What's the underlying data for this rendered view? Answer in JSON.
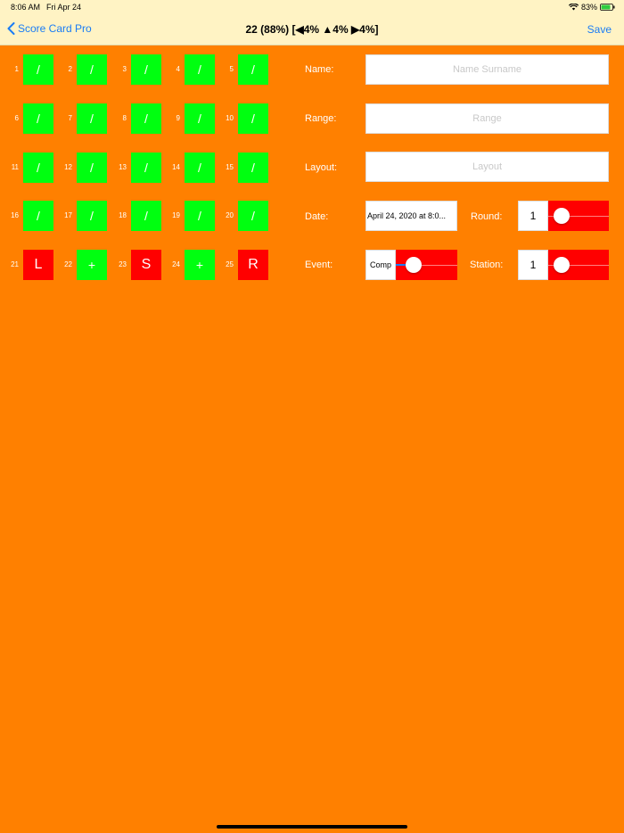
{
  "status": {
    "time": "8:06 AM",
    "date": "Fri Apr 24",
    "battery": "83%"
  },
  "nav": {
    "back_label": "Score Card Pro",
    "title": "22 (88%) [◀4% ▲4% ▶4%]",
    "save_label": "Save"
  },
  "grid": [
    {
      "n": "1",
      "v": "/",
      "c": "green"
    },
    {
      "n": "2",
      "v": "/",
      "c": "green"
    },
    {
      "n": "3",
      "v": "/",
      "c": "green"
    },
    {
      "n": "4",
      "v": "/",
      "c": "green"
    },
    {
      "n": "5",
      "v": "/",
      "c": "green"
    },
    {
      "n": "6",
      "v": "/",
      "c": "green"
    },
    {
      "n": "7",
      "v": "/",
      "c": "green"
    },
    {
      "n": "8",
      "v": "/",
      "c": "green"
    },
    {
      "n": "9",
      "v": "/",
      "c": "green"
    },
    {
      "n": "10",
      "v": "/",
      "c": "green"
    },
    {
      "n": "11",
      "v": "/",
      "c": "green"
    },
    {
      "n": "12",
      "v": "/",
      "c": "green"
    },
    {
      "n": "13",
      "v": "/",
      "c": "green"
    },
    {
      "n": "14",
      "v": "/",
      "c": "green"
    },
    {
      "n": "15",
      "v": "/",
      "c": "green"
    },
    {
      "n": "16",
      "v": "/",
      "c": "green"
    },
    {
      "n": "17",
      "v": "/",
      "c": "green"
    },
    {
      "n": "18",
      "v": "/",
      "c": "green"
    },
    {
      "n": "19",
      "v": "/",
      "c": "green"
    },
    {
      "n": "20",
      "v": "/",
      "c": "green"
    },
    {
      "n": "21",
      "v": "L",
      "c": "red"
    },
    {
      "n": "22",
      "v": "+",
      "c": "green"
    },
    {
      "n": "23",
      "v": "S",
      "c": "red"
    },
    {
      "n": "24",
      "v": "+",
      "c": "green"
    },
    {
      "n": "25",
      "v": "R",
      "c": "red"
    }
  ],
  "form": {
    "name_label": "Name:",
    "name_placeholder": "Name Surname",
    "range_label": "Range:",
    "range_placeholder": "Range",
    "layout_label": "Layout:",
    "layout_placeholder": "Layout",
    "date_label": "Date:",
    "date_value": "April 24, 2020 at 8:0...",
    "round_label": "Round:",
    "round_value": "1",
    "round_slider_fraction": 0.1,
    "event_label": "Event:",
    "event_value": "Comp",
    "event_slider_fraction": 0.2,
    "station_label": "Station:",
    "station_value": "1",
    "station_slider_fraction": 0.1
  },
  "colors": {
    "background": "#FF8000",
    "header": "#FFF3C4",
    "hit": "#00FF10",
    "miss": "#FF0000",
    "accent": "#1A7CF5"
  }
}
